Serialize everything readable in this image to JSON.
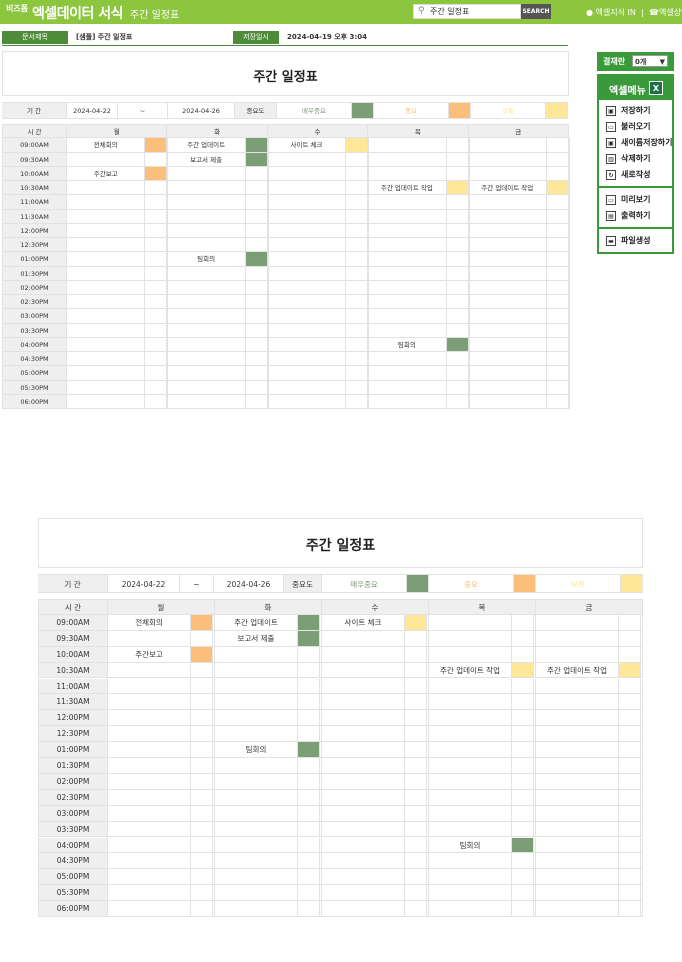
{
  "topbar": {
    "brand": "비즈폼",
    "app_title": "엑셀데이터 서식",
    "subtitle": "주간 일정표",
    "search_value": "주간 일정표",
    "search_button": "SEARCH",
    "link_knowledge": "엑셀지식 IN",
    "link_consult": "엑셀상담"
  },
  "docinfo": {
    "title_label": "문서제목",
    "title_value": "[샘플] 주간 일정표",
    "saved_label": "저장일시",
    "saved_value": "2024-04-19  오후 3:04"
  },
  "sidebar": {
    "approval_label": "결재란",
    "approval_value": "0개",
    "menu_title": "엑셀메뉴",
    "excel_icon": "excel-icon",
    "items": [
      {
        "label": "저장하기",
        "icon": "save-icon"
      },
      {
        "label": "불러오기",
        "icon": "load-icon"
      },
      {
        "label": "새이름저장하기",
        "icon": "save-as-icon"
      },
      {
        "label": "삭제하기",
        "icon": "delete-icon"
      },
      {
        "label": "새로작성",
        "icon": "new-icon"
      },
      {
        "label": "미리보기",
        "icon": "preview-icon"
      },
      {
        "label": "출력하기",
        "icon": "print-icon"
      },
      {
        "label": "파일생성",
        "icon": "folder-icon"
      }
    ]
  },
  "schedule": {
    "title": "주간 일정표",
    "period_label": "기 간",
    "start_date": "2024-04-22",
    "tilde": "~",
    "end_date": "2024-04-26",
    "importance_label": "중요도",
    "legend": [
      {
        "label": "매우중요",
        "color": "#7b9e76"
      },
      {
        "label": "중요",
        "color": "#fcbf7b"
      },
      {
        "label": "보통",
        "color": "#fde89a"
      }
    ],
    "time_header": "시 간",
    "days": [
      "월",
      "화",
      "수",
      "목",
      "금"
    ],
    "times": [
      "09:00AM",
      "09:30AM",
      "10:00AM",
      "10:30AM",
      "11:00AM",
      "11:30AM",
      "12:00PM",
      "12:30PM",
      "01:00PM",
      "01:30PM",
      "02:00PM",
      "02:30PM",
      "03:00PM",
      "03:30PM",
      "04:00PM",
      "04:30PM",
      "05:00PM",
      "05:30PM",
      "06:00PM"
    ],
    "events": [
      {
        "day": 0,
        "slot": 0,
        "text": "전체회의",
        "level": 1
      },
      {
        "day": 0,
        "slot": 2,
        "text": "주간보고",
        "level": 1
      },
      {
        "day": 1,
        "slot": 0,
        "text": "주간 업데이트",
        "level": 0
      },
      {
        "day": 1,
        "slot": 1,
        "text": "보고서 제출",
        "level": 0
      },
      {
        "day": 1,
        "slot": 8,
        "text": "팀회의",
        "level": 0
      },
      {
        "day": 2,
        "slot": 0,
        "text": "사이트 체크",
        "level": 2
      },
      {
        "day": 3,
        "slot": 3,
        "text": "주간 업데이트 작업",
        "level": 2
      },
      {
        "day": 3,
        "slot": 14,
        "text": "팀회의",
        "level": 0
      },
      {
        "day": 4,
        "slot": 3,
        "text": "주간 업데이트 작업",
        "level": 2
      }
    ]
  }
}
